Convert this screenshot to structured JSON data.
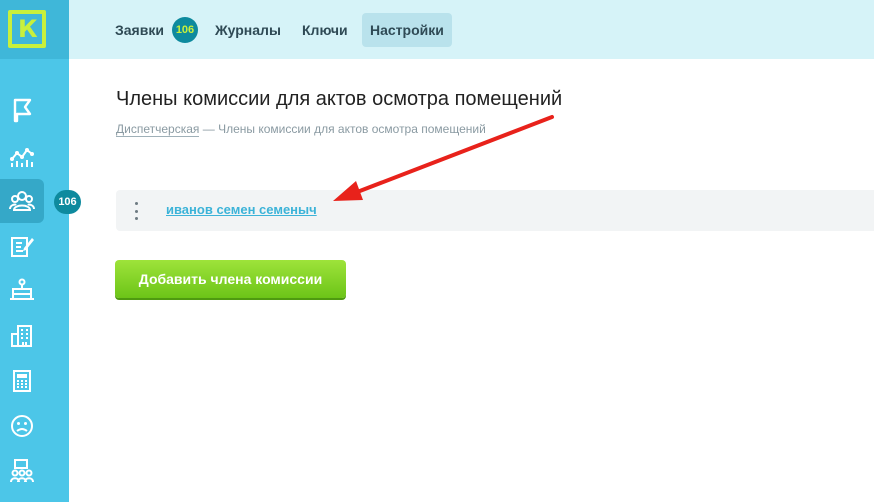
{
  "logo": {
    "letter": "К"
  },
  "sidebar": {
    "items": [
      {
        "icon": "flag-icon"
      },
      {
        "icon": "chart-icon"
      },
      {
        "icon": "users-group-icon",
        "active": true
      },
      {
        "icon": "edit-document-icon"
      },
      {
        "icon": "tray-icon"
      },
      {
        "icon": "building-icon"
      },
      {
        "icon": "calculator-icon"
      },
      {
        "icon": "sad-face-icon"
      },
      {
        "icon": "team-icon"
      }
    ],
    "badge": "106"
  },
  "topnav": {
    "tabs": [
      {
        "label": "Заявки"
      },
      {
        "label": "Журналы"
      },
      {
        "label": "Ключи"
      },
      {
        "label": "Настройки",
        "active": true
      }
    ],
    "requests_badge": "106"
  },
  "main": {
    "title": "Члены комиссии для актов осмотра помещений",
    "breadcrumb": {
      "link": "Диспетчерская",
      "separator": "—",
      "current": "Члены комиссии для актов осмотра помещений"
    },
    "members": [
      {
        "name": "иванов семен семеныч"
      }
    ],
    "add_button": "Добавить члена комиссии"
  },
  "colors": {
    "sidebar": "#4cc6e8",
    "topbar": "#d6f3f8",
    "accent_green": "#8bd42a",
    "badge": "#0e8a9e",
    "link": "#3cb3d8",
    "annotation_arrow": "#e8221b"
  }
}
